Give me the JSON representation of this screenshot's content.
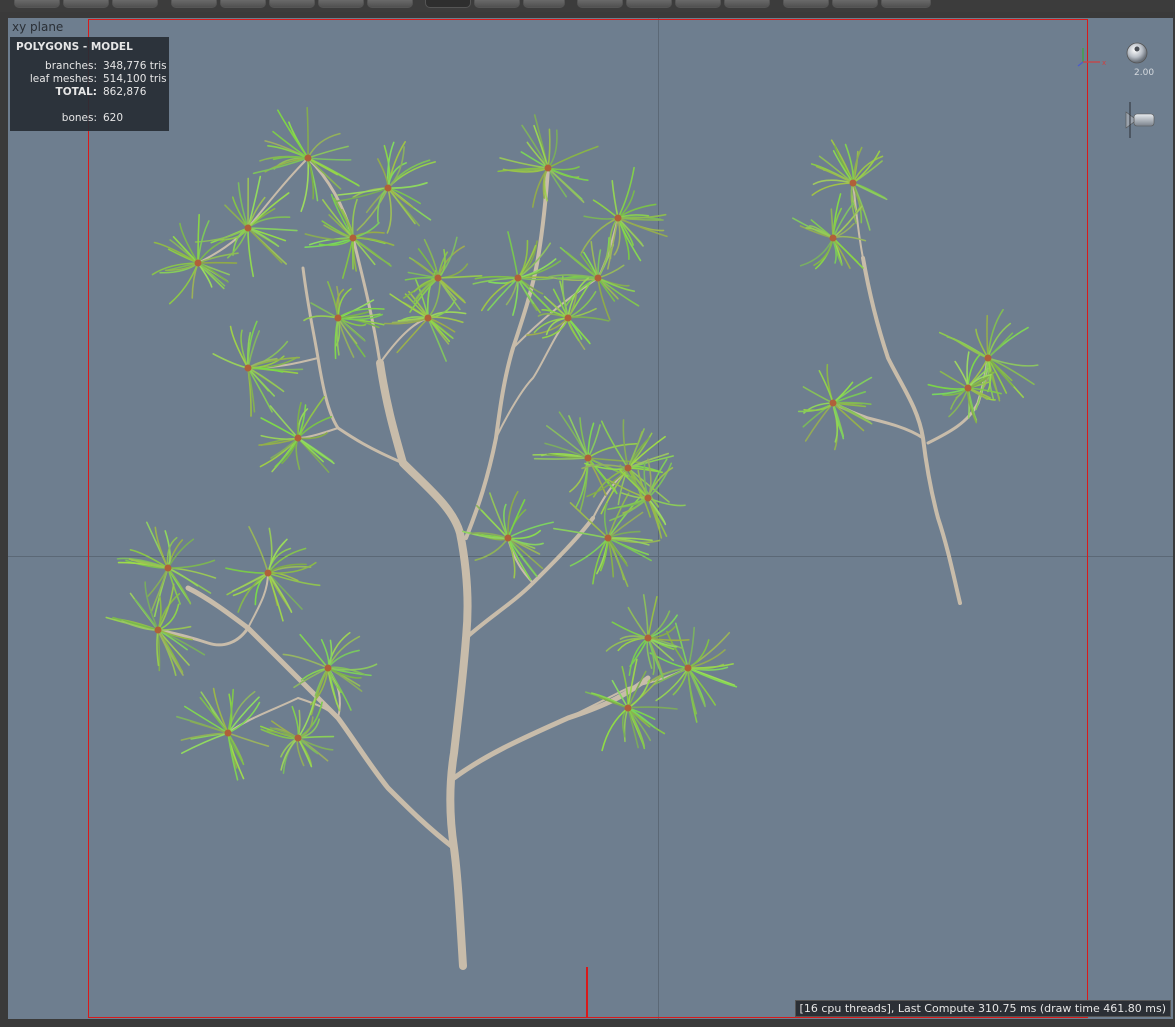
{
  "viewport": {
    "label": "xy plane",
    "zoom_value": "2.00",
    "status_text": "[16 cpu threads], Last Compute 310.75 ms (draw time 461.80 ms)"
  },
  "stats": {
    "title": "POLYGONS - MODEL",
    "rows": [
      {
        "label": "branches:",
        "value": "348,776 tris"
      },
      {
        "label": "leaf meshes:",
        "value": "514,100 tris"
      },
      {
        "label": "TOTAL:",
        "value": "862,876"
      },
      {
        "label": "bones:",
        "value": "620"
      }
    ]
  },
  "colors": {
    "viewport_bg": "#6e7e8f",
    "frame": "#d81a1a",
    "needle": "#9acd5a",
    "branch": "#c8bcaa"
  },
  "icons": {
    "axis_gizmo": "axis-gizmo-icon",
    "zoom": "zoom-knob-icon",
    "camera": "camera-icon"
  }
}
